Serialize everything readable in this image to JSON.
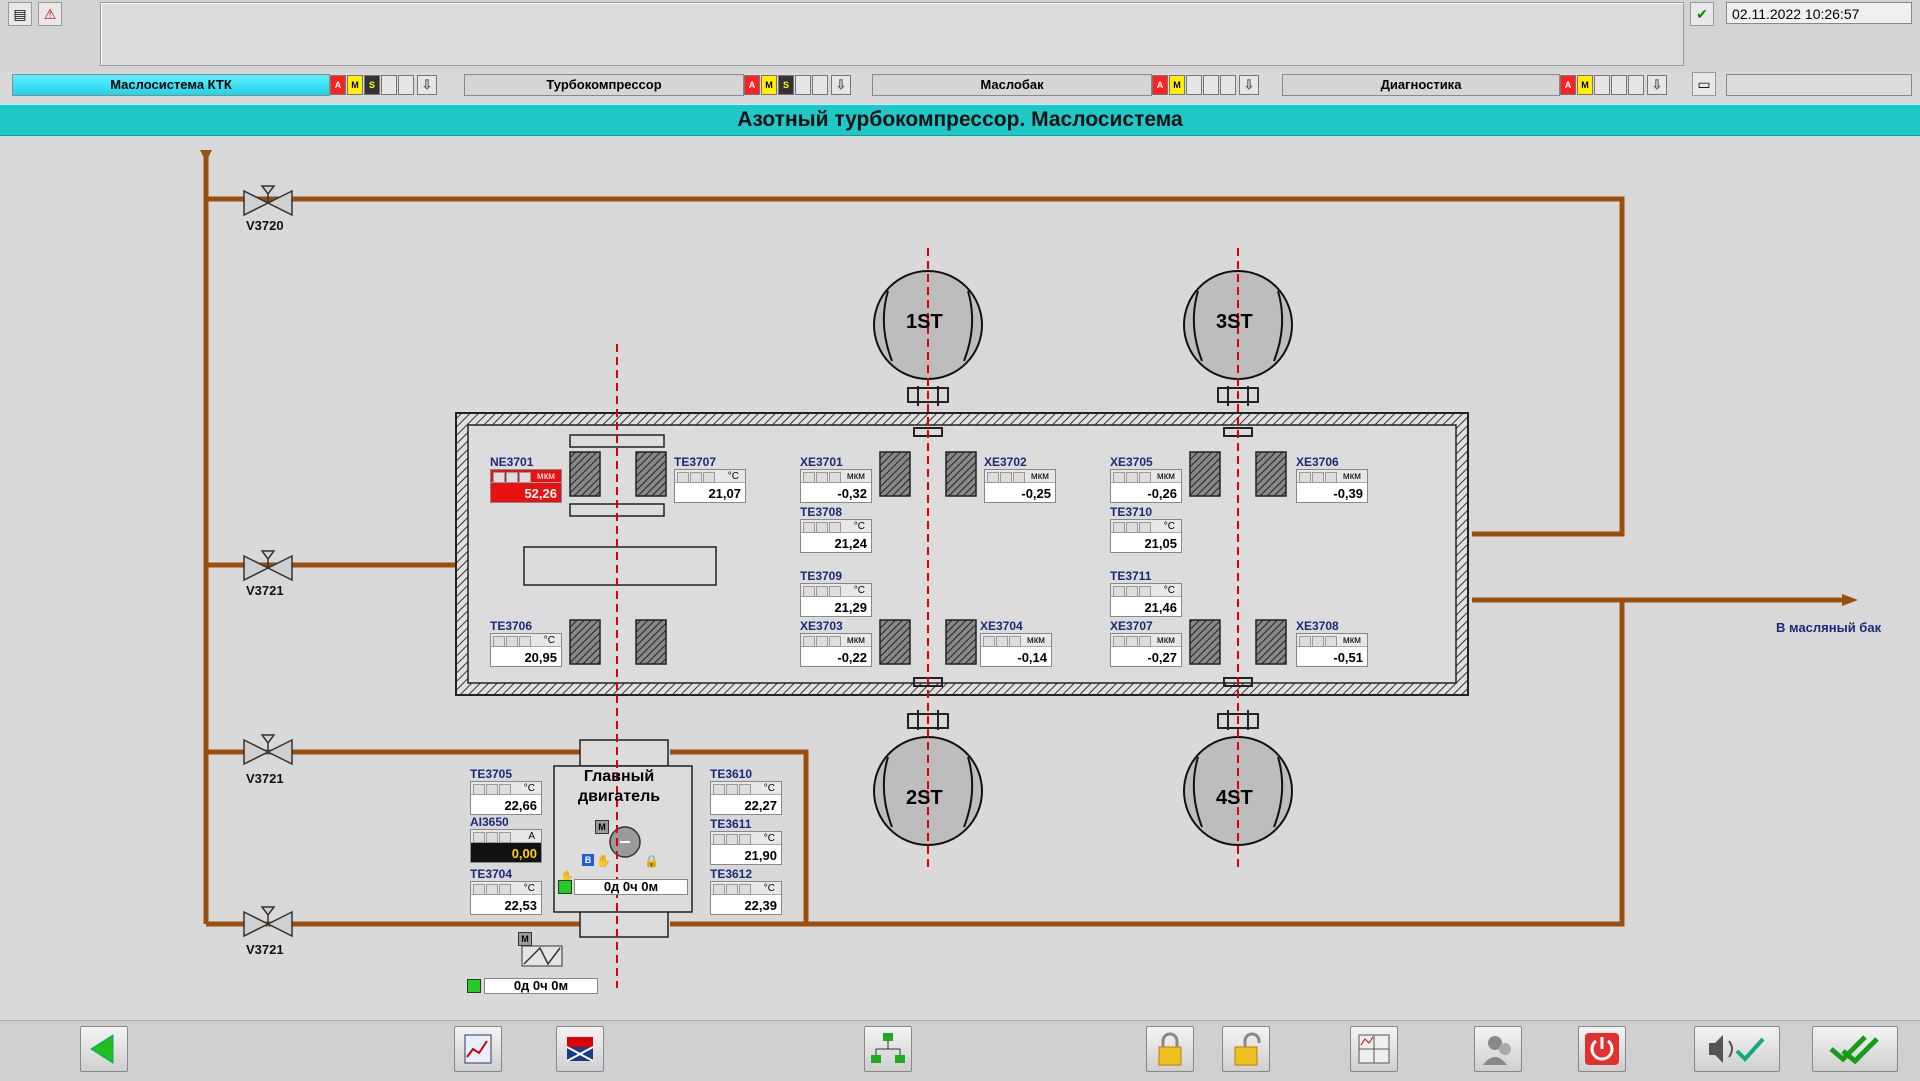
{
  "header": {
    "datetime": "02.11.2022 10:26:57"
  },
  "tabs": [
    {
      "label": "Маслосистема КТК",
      "flags": [
        "A",
        "M",
        "S"
      ],
      "active": true
    },
    {
      "label": "Турбокомпрессор",
      "flags": [
        "A",
        "M",
        "S"
      ],
      "active": false
    },
    {
      "label": "Маслобак",
      "flags": [
        "A",
        "M"
      ],
      "active": false
    },
    {
      "label": "Диагностика",
      "flags": [
        "A",
        "M"
      ],
      "active": false
    }
  ],
  "title": "Азотный турбокомпрессор. Маслосистема",
  "valves": {
    "v3720": "V3720",
    "v3721a": "V3721",
    "v3721b": "V3721",
    "v3721c": "V3721"
  },
  "outlet_label": "В масляный бак",
  "compressors": {
    "st1": "1ST",
    "st2": "2ST",
    "st3": "3ST",
    "st4": "4ST"
  },
  "motor": {
    "title_line1": "Главный",
    "title_line2": "двигатель",
    "runtime": "0д   0ч   0м",
    "m_label": "M",
    "b_label": "B"
  },
  "aux_runtime": "0д   0ч   0м",
  "aux_m_label": "M",
  "sensors": {
    "ne3701": {
      "tag": "NE3701",
      "unit": "мкм",
      "value": "52,26",
      "flag": "A"
    },
    "te3707": {
      "tag": "TE3707",
      "unit": "°C",
      "value": "21,07"
    },
    "te3706": {
      "tag": "TE3706",
      "unit": "°C",
      "value": "20,95"
    },
    "xe3701": {
      "tag": "XE3701",
      "unit": "мкм",
      "value": "-0,32"
    },
    "xe3702": {
      "tag": "XE3702",
      "unit": "мкм",
      "value": "-0,25"
    },
    "te3708": {
      "tag": "TE3708",
      "unit": "°C",
      "value": "21,24"
    },
    "te3709": {
      "tag": "TE3709",
      "unit": "°C",
      "value": "21,29"
    },
    "xe3703": {
      "tag": "XE3703",
      "unit": "мкм",
      "value": "-0,22"
    },
    "xe3704": {
      "tag": "XE3704",
      "unit": "мкм",
      "value": "-0,14"
    },
    "xe3705": {
      "tag": "XE3705",
      "unit": "мкм",
      "value": "-0,26"
    },
    "xe3706": {
      "tag": "XE3706",
      "unit": "мкм",
      "value": "-0,39"
    },
    "te3710": {
      "tag": "TE3710",
      "unit": "°C",
      "value": "21,05"
    },
    "te3711": {
      "tag": "TE3711",
      "unit": "°C",
      "value": "21,46"
    },
    "xe3707": {
      "tag": "XE3707",
      "unit": "мкм",
      "value": "-0,27"
    },
    "xe3708": {
      "tag": "XE3708",
      "unit": "мкм",
      "value": "-0,51"
    },
    "te3705": {
      "tag": "TE3705",
      "unit": "°C",
      "value": "22,66"
    },
    "ai3650": {
      "tag": "AI3650",
      "unit": "A",
      "value": "0,00",
      "flag": "S"
    },
    "te3704": {
      "tag": "TE3704",
      "unit": "°C",
      "value": "22,53"
    },
    "te3610": {
      "tag": "TE3610",
      "unit": "°C",
      "value": "22,27"
    },
    "te3611": {
      "tag": "TE3611",
      "unit": "°C",
      "value": "21,90"
    },
    "te3612": {
      "tag": "TE3612",
      "unit": "°C",
      "value": "22,39"
    }
  },
  "colors": {
    "pipe": "#b05a10",
    "accent": "#1fc8c8",
    "alarm": "#e81010",
    "centerline": "#e00000"
  }
}
